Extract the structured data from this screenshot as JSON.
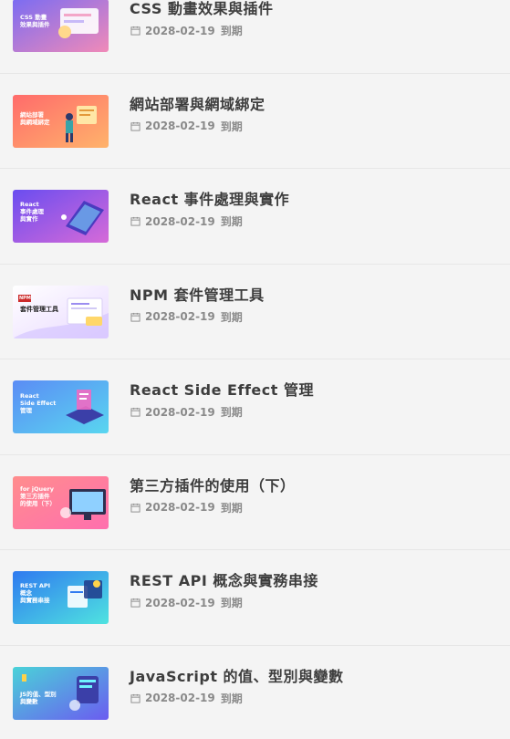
{
  "courses": [
    {
      "title": "CSS 動畫效果與插件",
      "thumb_text": "CSS 動畫\n效果與插件",
      "date": "2028-02-19",
      "status": "到期",
      "thumb_colors": [
        "#7b6cf2",
        "#f08ab8"
      ]
    },
    {
      "title": "網站部署與網域綁定",
      "thumb_text": "網站部署\n與網域綁定",
      "date": "2028-02-19",
      "status": "到期",
      "thumb_colors": [
        "#ff6b6b",
        "#ffb36b"
      ]
    },
    {
      "title": "React 事件處理與實作",
      "thumb_text": "React\n事件處理\n與實作",
      "date": "2028-02-19",
      "status": "到期",
      "thumb_colors": [
        "#6a4df0",
        "#d66ad8"
      ]
    },
    {
      "title": "NPM 套件管理工具",
      "thumb_text": "套件管理工具",
      "thumb_badge": "NPM",
      "date": "2028-02-19",
      "status": "到期",
      "thumb_colors": [
        "#ffffff",
        "#e9d9ff"
      ]
    },
    {
      "title": "React Side Effect 管理",
      "thumb_text": "React\nSide Effect\n管理",
      "date": "2028-02-19",
      "status": "到期",
      "thumb_colors": [
        "#5b8cf5",
        "#59d6f0"
      ]
    },
    {
      "title": "第三方插件的使用（下）",
      "thumb_text": "for jQuery\n第三方插件\n的使用（下）",
      "date": "2028-02-19",
      "status": "到期",
      "thumb_colors": [
        "#ff8d8d",
        "#ff6fae"
      ]
    },
    {
      "title": "REST API 概念與實務串接",
      "thumb_text": "REST API\n概念\n與實務串接",
      "date": "2028-02-19",
      "status": "到期",
      "thumb_colors": [
        "#2f7af0",
        "#4fe3e0"
      ]
    },
    {
      "title": "JavaScript 的值、型別與變數",
      "thumb_text": "JS的值、型別\n與變數",
      "date": "2028-02-19",
      "status": "到期",
      "thumb_colors": [
        "#4ad2d8",
        "#6b5cf0"
      ]
    }
  ]
}
